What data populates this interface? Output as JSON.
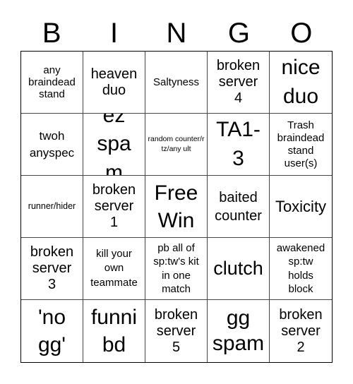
{
  "header": {
    "letters": [
      "B",
      "I",
      "N",
      "G",
      "O"
    ]
  },
  "cells": [
    "any braindead stand",
    "heaven duo",
    "Saltyness",
    "broken server 4",
    "nice duo",
    "twoh anyspec",
    "ez spam",
    "random counter/rtz/any ult",
    "TA1-3",
    "Trash braindead stand user(s)",
    "runner/hider",
    "broken server 1",
    "Free Win",
    "baited counter",
    "Toxicity",
    "broken server 3",
    "kill your own teammate",
    "pb all of sp:tw's kit in one match",
    "clutch",
    "awakened sp:tw holds block",
    "'no gg'",
    "funni bd",
    "broken server 5",
    "gg spam",
    "broken server 2"
  ]
}
